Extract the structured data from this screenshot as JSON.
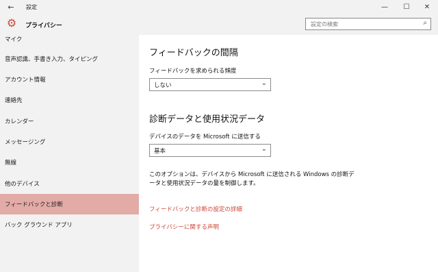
{
  "window": {
    "title": "設定",
    "back_glyph": "←",
    "minimize_glyph": "—",
    "maximize_glyph": "☐",
    "close_glyph": "✕"
  },
  "header": {
    "title": "プライバシー",
    "icon": "gear-icon",
    "accent_color": "#d14636"
  },
  "search": {
    "placeholder": "設定の検索",
    "icon": "search-icon"
  },
  "sidebar": {
    "items": [
      {
        "label": "マイク"
      },
      {
        "label": "音声認識、手書き入力、タイピング"
      },
      {
        "label": "アカウント情報"
      },
      {
        "label": "連絡先"
      },
      {
        "label": "カレンダー"
      },
      {
        "label": "メッセージング"
      },
      {
        "label": "無線"
      },
      {
        "label": "他のデバイス"
      },
      {
        "label": "フィードバックと診断",
        "active": true
      },
      {
        "label": "バック グラウンド アプリ"
      }
    ],
    "active_color": "#e3aba6"
  },
  "main": {
    "feedback_heading": "フィードバックの間隔",
    "feedback_label": "フィードバックを求められる頻度",
    "feedback_value": "しない",
    "diag_heading": "診断データと使用状況データ",
    "diag_label": "デバイスのデータを Microsoft に送信する",
    "diag_value": "基本",
    "description": "このオプションは、デバイスから Microsoft に送信される Windows の診断データと使用状況データの量を制御します。",
    "link_details": "フィードバックと診断の設定の詳細",
    "link_privacy": "プライバシーに関する声明"
  }
}
